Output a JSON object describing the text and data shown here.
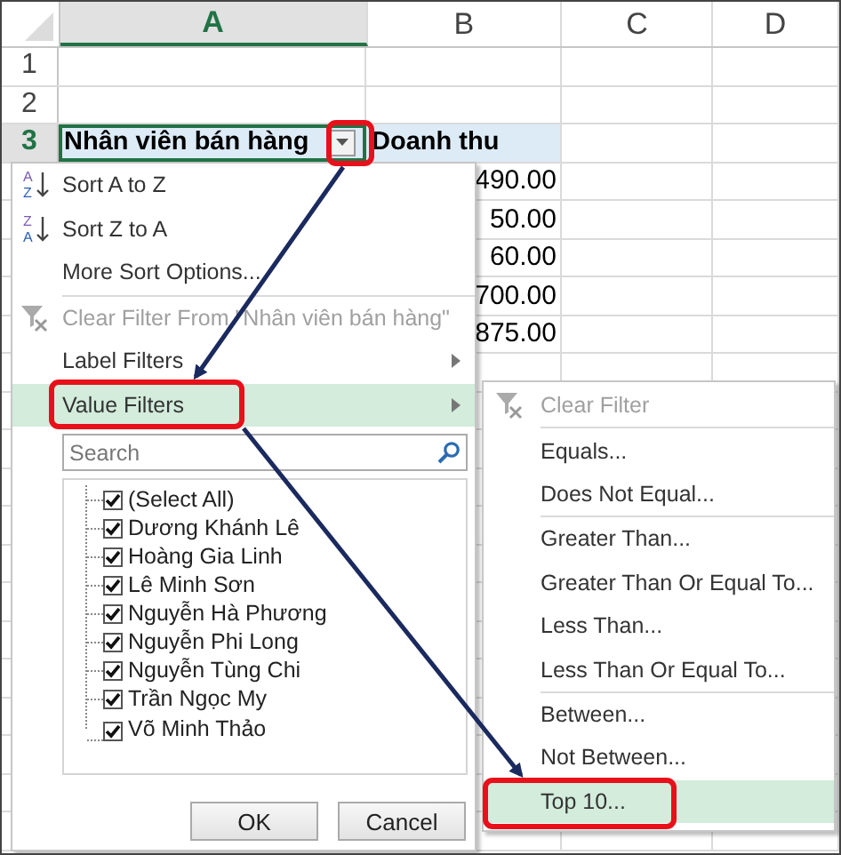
{
  "columns": [
    {
      "label": "A",
      "selected": true
    },
    {
      "label": "B",
      "selected": false
    },
    {
      "label": "C",
      "selected": false
    },
    {
      "label": "D",
      "selected": false
    }
  ],
  "rows": [
    {
      "number": "1",
      "selected": false
    },
    {
      "number": "2",
      "selected": false
    },
    {
      "number": "3",
      "selected": true,
      "header": true,
      "a": "Nhân viên bán hàng",
      "b": "Doanh thu"
    },
    {
      "b": "490.00"
    },
    {
      "b": "50.00"
    },
    {
      "b": "60.00"
    },
    {
      "b": "700.00"
    },
    {
      "b": "875.00"
    },
    {},
    {},
    {},
    {},
    {},
    {},
    {},
    {},
    {},
    {},
    {},
    {},
    {}
  ],
  "menu": {
    "items": [
      {
        "kind": "sort",
        "icon_letters": [
          "A",
          "Z"
        ],
        "label": "Sort A to Z",
        "disabled": false,
        "selected": false,
        "submenu": false
      },
      {
        "kind": "sort",
        "icon_letters": [
          "Z",
          "A"
        ],
        "label": "Sort Z to A",
        "disabled": false,
        "selected": false,
        "submenu": false
      },
      {
        "kind": "command",
        "label": "More Sort Options...",
        "disabled": false,
        "selected": false,
        "submenu": false
      },
      {
        "kind": "separator"
      },
      {
        "kind": "clear-filter",
        "label": "Clear Filter From \"Nhân viên bán hàng\"",
        "disabled": true,
        "selected": false,
        "submenu": false
      },
      {
        "kind": "command",
        "label": "Label Filters",
        "disabled": false,
        "selected": false,
        "submenu": true
      },
      {
        "kind": "command",
        "label": "Value Filters",
        "disabled": false,
        "selected": true,
        "submenu": true
      }
    ],
    "search": {
      "placeholder": "Search"
    },
    "list": [
      {
        "label": "(Select All)",
        "checked": true
      },
      {
        "label": "Dương Khánh Lê",
        "checked": true
      },
      {
        "label": "Hoàng Gia Linh",
        "checked": true
      },
      {
        "label": "Lê Minh Sơn",
        "checked": true
      },
      {
        "label": "Nguyễn Hà Phương",
        "checked": true
      },
      {
        "label": "Nguyễn Phi Long",
        "checked": true
      },
      {
        "label": "Nguyễn Tùng Chi",
        "checked": true
      },
      {
        "label": "Trần Ngọc My",
        "checked": true
      },
      {
        "label": "Võ Minh Thảo",
        "checked": true
      }
    ],
    "buttons": [
      "OK",
      "Cancel"
    ]
  },
  "submenu": {
    "items": [
      {
        "kind": "clear-filter",
        "label": "Clear Filter",
        "disabled": true,
        "selected": false
      },
      {
        "kind": "separator"
      },
      {
        "kind": "command",
        "label": "Equals...",
        "disabled": false,
        "selected": false
      },
      {
        "kind": "command",
        "label": "Does Not Equal...",
        "disabled": false,
        "selected": false
      },
      {
        "kind": "separator"
      },
      {
        "kind": "command",
        "label": "Greater Than...",
        "disabled": false,
        "selected": false
      },
      {
        "kind": "command",
        "label": "Greater Than Or Equal To...",
        "disabled": false,
        "selected": false
      },
      {
        "kind": "command",
        "label": "Less Than...",
        "disabled": false,
        "selected": false
      },
      {
        "kind": "command",
        "label": "Less Than Or Equal To...",
        "disabled": false,
        "selected": false
      },
      {
        "kind": "separator"
      },
      {
        "kind": "command",
        "label": "Between...",
        "disabled": false,
        "selected": false
      },
      {
        "kind": "command",
        "label": "Not Between...",
        "disabled": false,
        "selected": false
      },
      {
        "kind": "command",
        "label": "Top 10...",
        "disabled": false,
        "selected": true
      }
    ]
  }
}
